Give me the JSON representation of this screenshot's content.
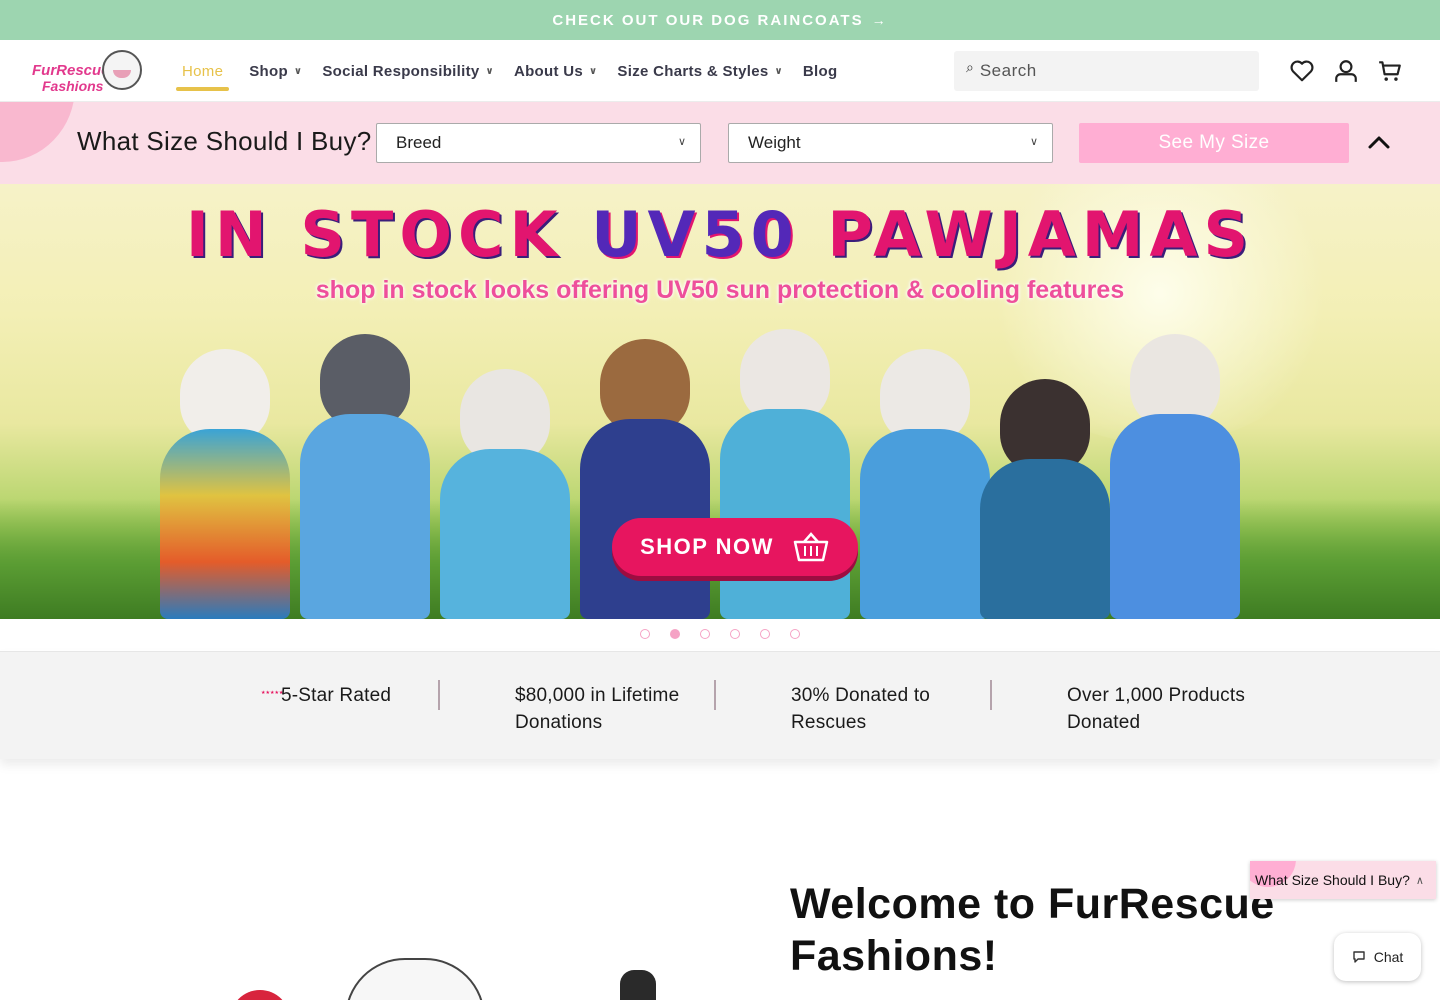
{
  "announcement": {
    "text": "CHECK OUT OUR DOG RAINCOATS",
    "arrow": "→"
  },
  "header": {
    "logo": {
      "line1": "FurRescue",
      "line2": "Fashions"
    },
    "nav": [
      {
        "label": "Home",
        "active": true,
        "has_dropdown": false
      },
      {
        "label": "Shop",
        "active": false,
        "has_dropdown": true
      },
      {
        "label": "Social Responsibility",
        "active": false,
        "has_dropdown": true
      },
      {
        "label": "About Us",
        "active": false,
        "has_dropdown": true
      },
      {
        "label": "Size Charts & Styles",
        "active": false,
        "has_dropdown": true
      },
      {
        "label": "Blog",
        "active": false,
        "has_dropdown": false
      }
    ],
    "search": {
      "placeholder": "Search",
      "icon": "search-icon"
    },
    "icons": [
      "heart-icon",
      "account-icon",
      "cart-icon"
    ]
  },
  "size_finder": {
    "title": "What Size Should I Buy?",
    "breed": {
      "value": "Breed"
    },
    "weight": {
      "value": "Weight"
    },
    "button": "See My Size",
    "collapse_icon": "chevron-up-icon"
  },
  "hero": {
    "headline_part1": "IN STOCK",
    "headline_part2": "UV50",
    "headline_part3": "PAWJAMAS",
    "subline": "shop in stock looks offering UV50 sun protection & cooling features",
    "cta": "SHOP NOW",
    "slides_count": 6,
    "active_slide": 2
  },
  "trust": [
    {
      "line1": "5-Star Rated",
      "line2": ""
    },
    {
      "line1": "$80,000 in Lifetime",
      "line2": "Donations"
    },
    {
      "line1": "30% Donated to",
      "line2": "Rescues"
    },
    {
      "line1": "Over 1,000 Products",
      "line2": "Donated"
    }
  ],
  "welcome": {
    "title": "Welcome to FurRescue Fashions!"
  },
  "floating": {
    "size_label": "What Size Should I Buy?",
    "chat_label": "Chat"
  },
  "colors": {
    "announcement_bg": "#9dd5b0",
    "accent_pink": "#ffaed3",
    "size_bar_bg": "#fbdde7",
    "nav_active": "#e7c24a",
    "hero_magenta": "#e2156f"
  }
}
